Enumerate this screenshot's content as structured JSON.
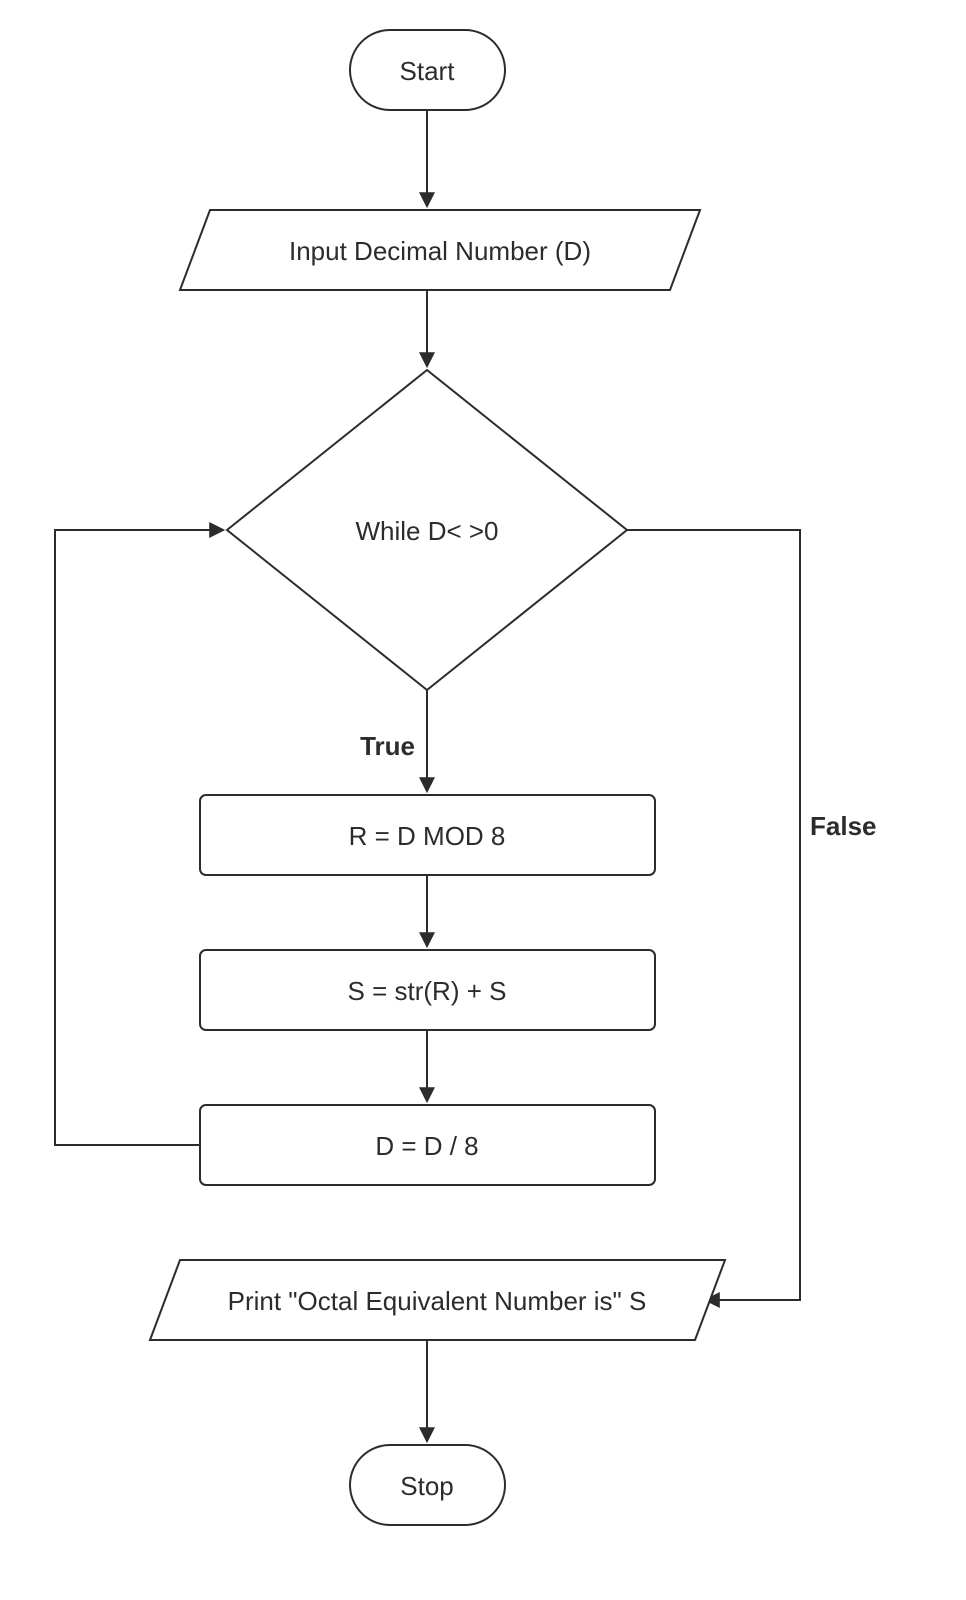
{
  "nodes": {
    "start": "Start",
    "input": "Input  Decimal Number (D)",
    "decision": "While  D< >0",
    "proc1": "R = D MOD 8",
    "proc2": "S = str(R) + S",
    "proc3": "D = D / 8",
    "output": "Print \"Octal Equivalent Number is\"  S",
    "stop": "Stop"
  },
  "edges": {
    "true": "True",
    "false": "False"
  }
}
